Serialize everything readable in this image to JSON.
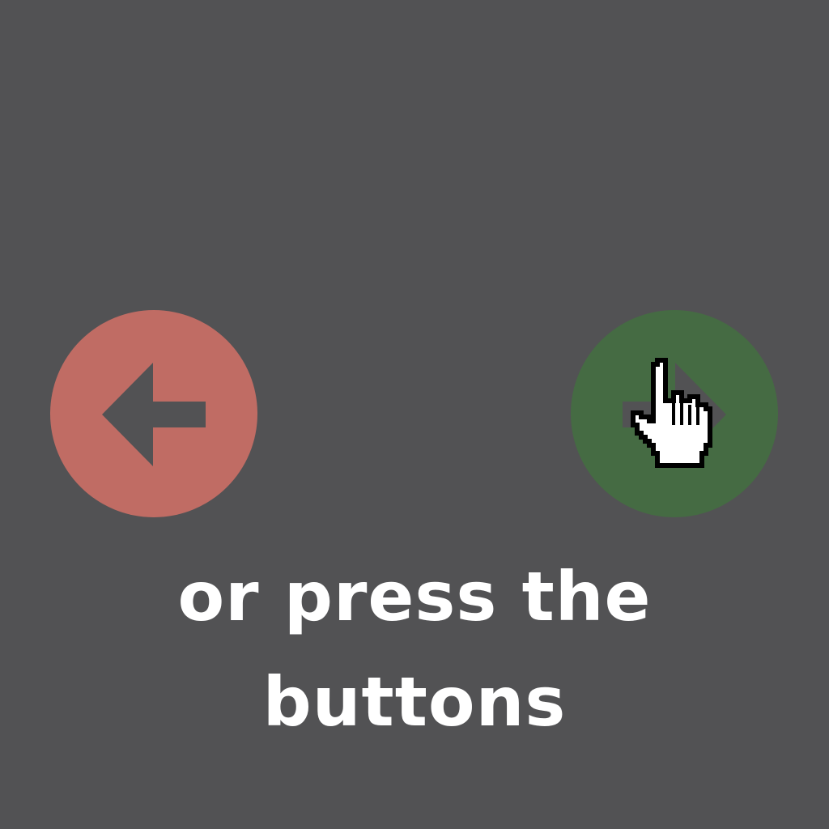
{
  "colors": {
    "background": "#525254",
    "prev_button": "#c06c64",
    "next_button": "#456b43",
    "arrow": "#525254",
    "text": "#ffffff"
  },
  "prev_button": {
    "icon": "arrow-left-icon"
  },
  "next_button": {
    "icon": "arrow-right-icon"
  },
  "cursor": {
    "icon": "hand-pointer-icon"
  },
  "instruction": {
    "line1": "or press the",
    "line2": "buttons"
  }
}
